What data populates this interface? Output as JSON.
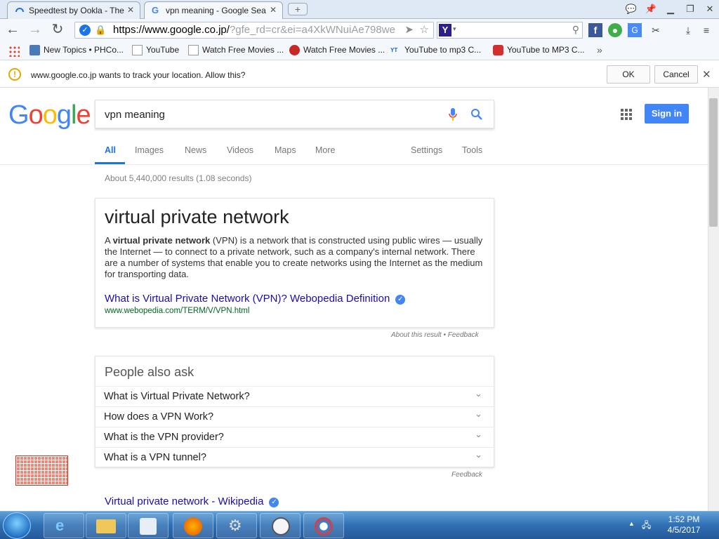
{
  "browser": {
    "tabs": [
      {
        "title": "Speedtest by Ookla - The"
      },
      {
        "title": "vpn meaning - Google Sea"
      }
    ],
    "url_main": "https://www.google.co.jp/",
    "url_rest": "?gfe_rd=cr&ei=a4XkWNuiAe798we",
    "bookmarks": [
      {
        "label": "New Topics • PHCo..."
      },
      {
        "label": "YouTube"
      },
      {
        "label": "Watch Free Movies ..."
      },
      {
        "label": "Watch Free Movies ..."
      },
      {
        "label": "YouTube to mp3 C..."
      },
      {
        "label": "YouTube to MP3 C..."
      }
    ],
    "infobar": {
      "message": "www.google.co.jp wants to track your location. Allow this?",
      "ok": "OK",
      "cancel": "Cancel"
    }
  },
  "google": {
    "query": "vpn meaning",
    "signin": "Sign in",
    "tabs": [
      "All",
      "Images",
      "News",
      "Videos",
      "Maps",
      "More",
      "Settings",
      "Tools"
    ],
    "stats": "About 5,440,000 results (1.08 seconds)",
    "knowledge": {
      "title": "virtual private network",
      "text_a": "A ",
      "text_bold": "virtual private network",
      "text_b": " (VPN) is a network that is constructed using public wires — usually the Internet — to connect to a private network, such as a company's internal network. There are a number of systems that enable you to create networks using the Internet as the medium for transporting data.",
      "link": "What is Virtual Private Network (VPN)? Webopedia Definition",
      "url": "www.webopedia.com/TERM/V/VPN.html",
      "about": "About this result • Feedback"
    },
    "paa": {
      "title": "People also ask",
      "questions": [
        "What is Virtual Private Network?",
        "How does a VPN Work?",
        "What is the VPN provider?",
        "What is a VPN tunnel?"
      ],
      "feedback": "Feedback"
    },
    "wiki_link": "Virtual private network - Wikipedia"
  },
  "taskbar": {
    "time": "1:52 PM",
    "date": "4/5/2017"
  }
}
